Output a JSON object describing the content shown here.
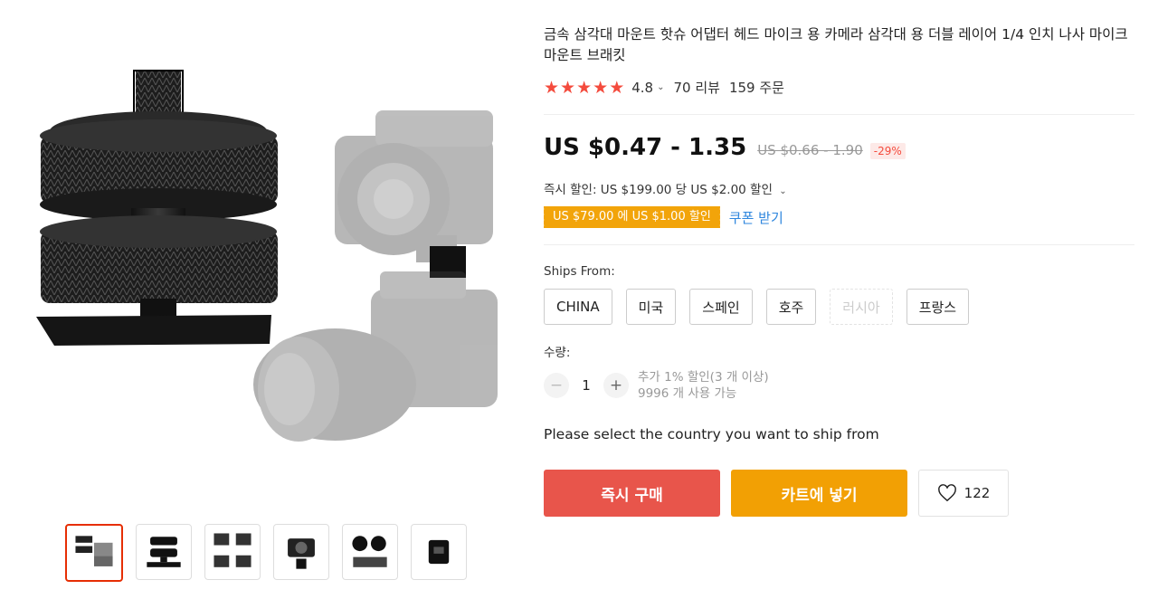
{
  "product": {
    "title": "금속 삼각대 마운트 핫슈 어댑터 헤드 마이크 용 카메라 삼각대 용 더블 레이어 1/4 인치 나사 마이크 마운트 브래킷",
    "rating": "4.8",
    "reviews": "70 리뷰",
    "orders": "159 주문",
    "stars": 5
  },
  "price": {
    "current": "US $0.47 - 1.35",
    "original": "US $0.66 - 1.90",
    "discount": "-29%",
    "instant_discount": "즉시 할인: US $199.00 당 US $2.00 할인",
    "coupon_badge": "US $79.00 에 US $1.00 할인",
    "coupon_link": "쿠폰 받기"
  },
  "shipping": {
    "label": "Ships From:",
    "options": [
      "CHINA",
      "미국",
      "스페인",
      "호주",
      "러시아",
      "프랑스"
    ],
    "message": "Please select the country you want to ship from"
  },
  "quantity": {
    "label": "수량:",
    "value": "1",
    "minus": "−",
    "plus": "+",
    "note_line1": "추가 1% 할인(3 개 이상)",
    "note_line2": "9996 개 사용 가능"
  },
  "actions": {
    "buy_now": "즉시 구매",
    "add_to_cart": "카트에 넣기",
    "wishlist_count": "122"
  },
  "colors": {
    "star": "#f44b3d",
    "buy": "#e8554b",
    "cart": "#f2a004",
    "coupon": "#f2a40a",
    "link": "#2e86de"
  },
  "icons": {
    "star": "star-icon",
    "chevron": "chevron-down-icon",
    "wishlist": "heart-icon"
  }
}
